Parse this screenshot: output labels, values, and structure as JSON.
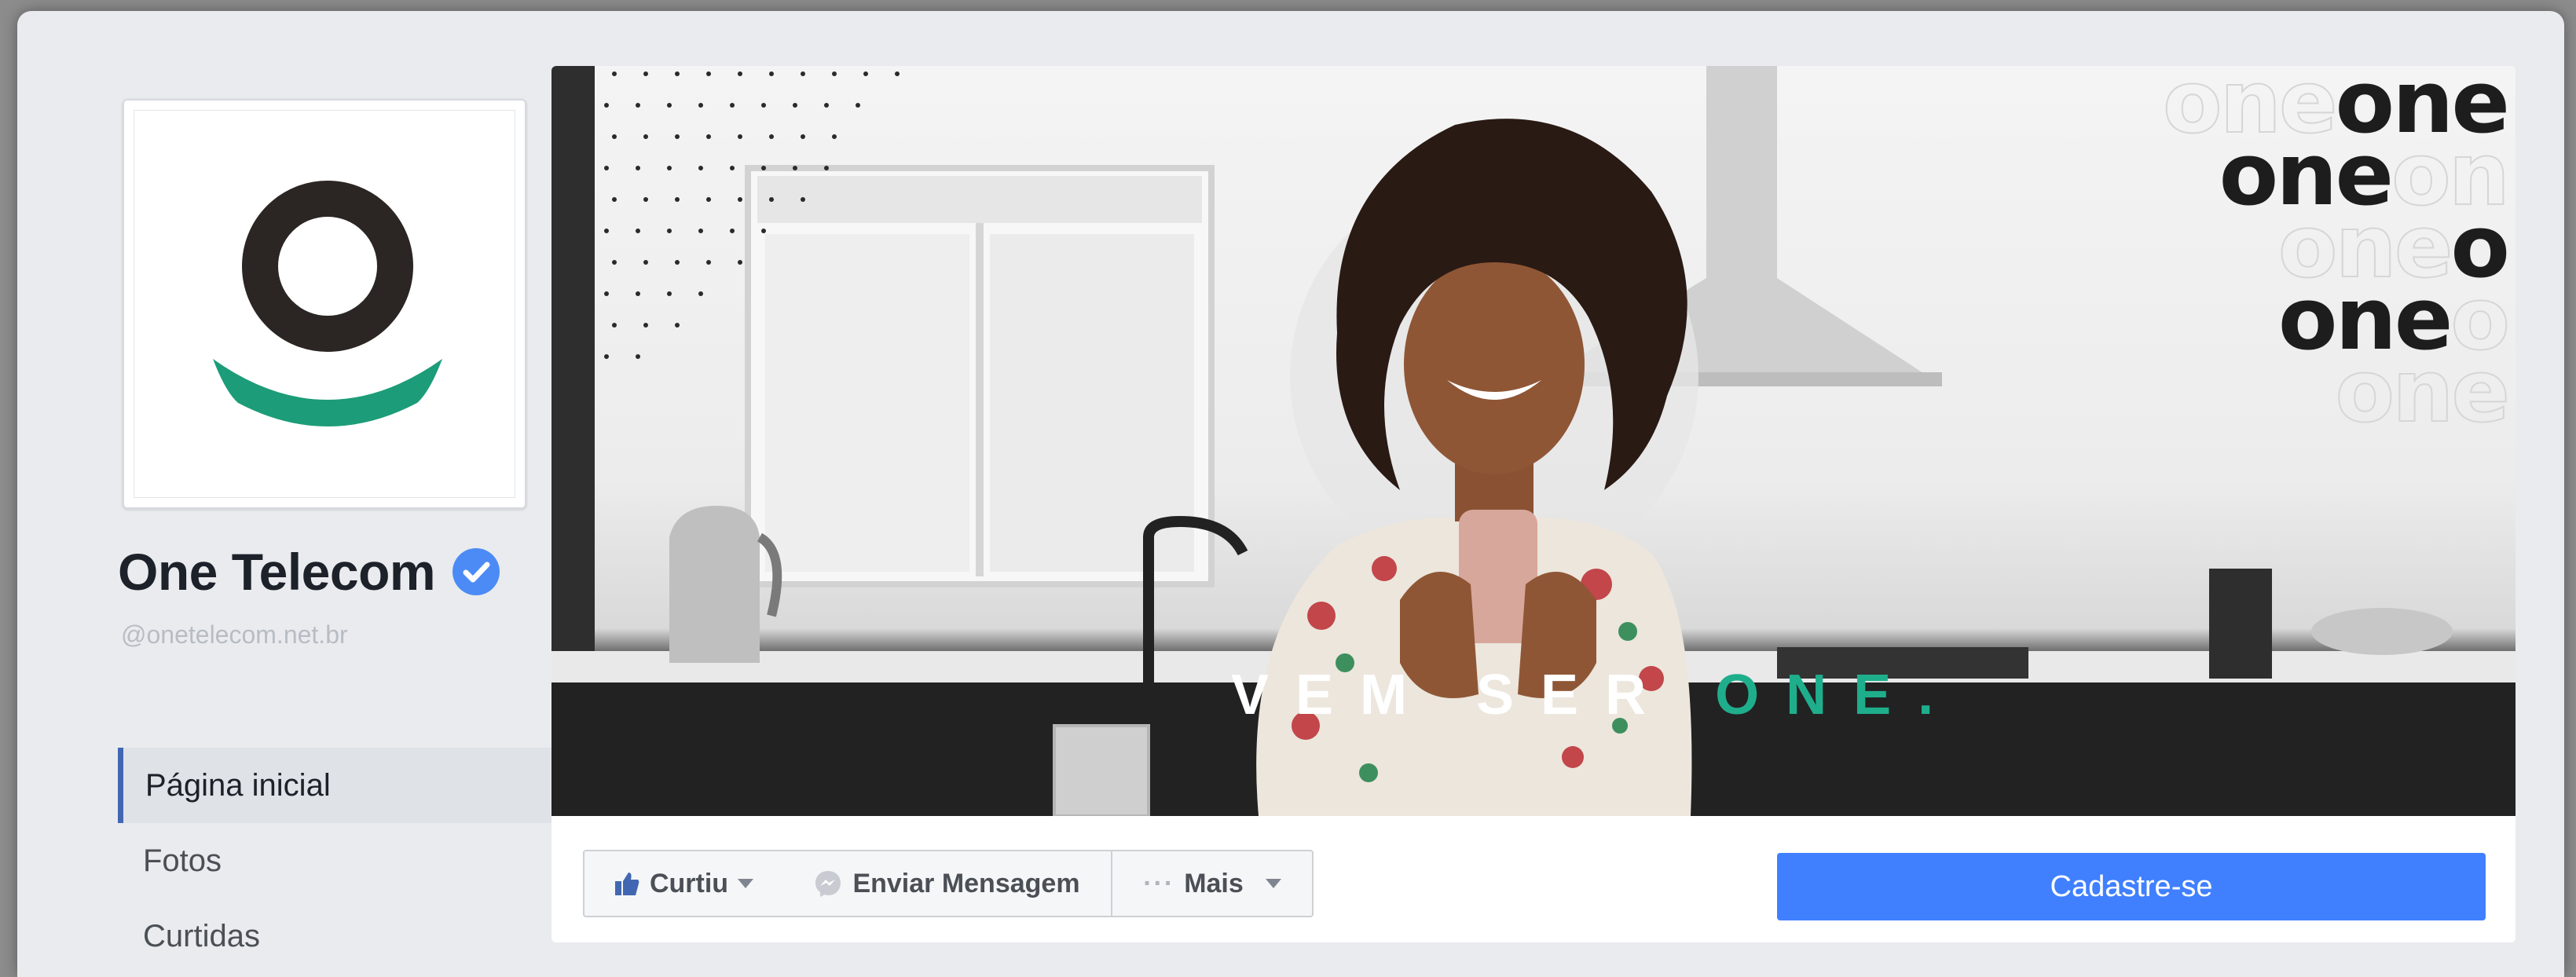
{
  "page": {
    "name": "One Telecom",
    "handle": "@onetelecom.net.br",
    "verified": true
  },
  "nav": {
    "items": [
      {
        "label": "Página inicial",
        "active": true
      },
      {
        "label": "Fotos",
        "active": false
      },
      {
        "label": "Curtidas",
        "active": false
      }
    ]
  },
  "cover": {
    "tagline_main": "VEM SER",
    "tagline_accent": "ONE.",
    "brand_words": [
      "one",
      "one",
      "one",
      "one",
      "one"
    ]
  },
  "actions": {
    "like_label": "Curtiu",
    "message_label": "Enviar Mensagem",
    "more_label": "Mais",
    "signup_label": "Cadastre-se"
  },
  "colors": {
    "brand_dark": "#2b2523",
    "brand_green": "#1c9c78",
    "accent_blue": "#4080ff",
    "verified_blue": "#4c8bf5"
  },
  "icons": {
    "like": "thumbs-up-icon",
    "message": "messenger-icon",
    "more": "ellipsis-icon"
  }
}
